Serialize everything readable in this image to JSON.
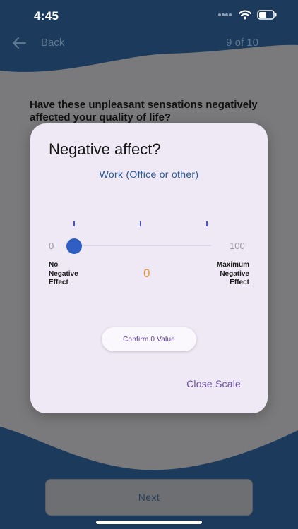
{
  "status_bar": {
    "time": "4:45"
  },
  "nav": {
    "back_label": "Back",
    "progress": "9 of 10"
  },
  "question": "Have these unpleasant sensations negatively affected your quality of life?",
  "next_label": "Next",
  "modal": {
    "title": "Negative affect?",
    "subtitle": "Work (Office or other)",
    "scale": {
      "min": 0,
      "max": 100,
      "value": 0,
      "min_text": "0",
      "max_text": "100",
      "value_text": "0",
      "min_label": [
        "No",
        "Negative",
        "Effect"
      ],
      "max_label": [
        "Maximum",
        "Negative",
        "Effect"
      ]
    },
    "confirm_label": "Confirm 0 Value",
    "close_label": "Close Scale"
  },
  "colors": {
    "header_navy": "#1c3a5b",
    "overlay_gray": "#7a7a7c",
    "modal_bg": "#efe9f6",
    "thumb_blue": "#2f5fc3",
    "value_orange": "#ea9637",
    "accent_purple": "#6a4fa0"
  }
}
